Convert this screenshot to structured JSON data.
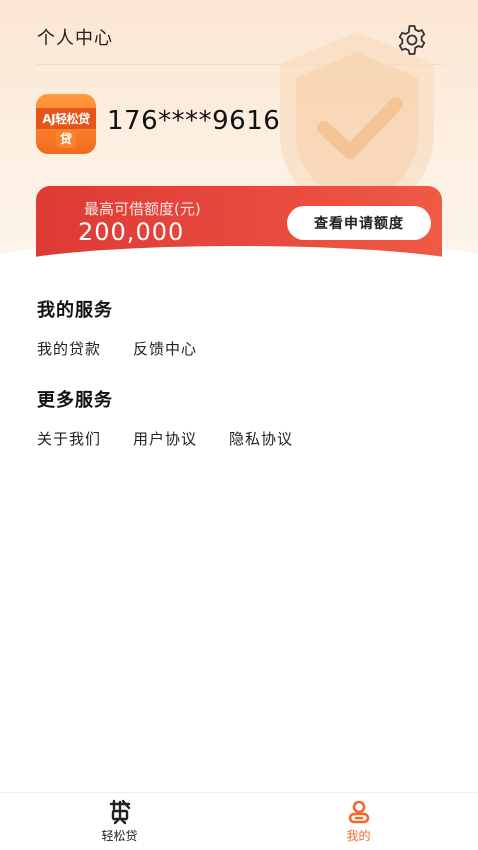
{
  "header": {
    "title": "个人中心",
    "settings_icon": "gear-icon"
  },
  "profile": {
    "logo_text": "AJ轻松贷",
    "logo_sub": "贷",
    "phone": "176****9616"
  },
  "credit": {
    "label": "最高可借额度(元)",
    "amount": "200,000",
    "check_button": "查看申请额度"
  },
  "my_services": {
    "title": "我的服务",
    "items": [
      "我的贷款",
      "反馈中心"
    ]
  },
  "more_services": {
    "title": "更多服务",
    "items": [
      "关于我们",
      "用户协议",
      "隐私协议"
    ]
  },
  "tabbar": {
    "tabs": [
      {
        "label": "轻松贷",
        "icon": "loan-icon",
        "active": false
      },
      {
        "label": "我的",
        "icon": "user-icon",
        "active": true
      }
    ],
    "active_color": "#f06a2a"
  },
  "colors": {
    "accent_red": "#e2403a",
    "accent_orange": "#f06a2a"
  }
}
